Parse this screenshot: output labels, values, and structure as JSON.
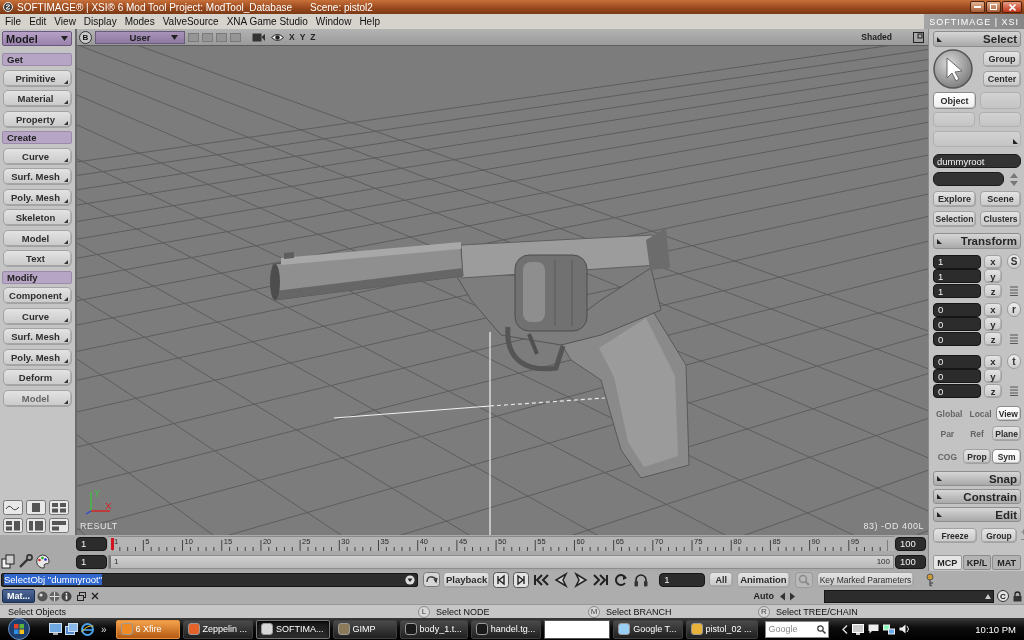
{
  "window": {
    "title": "SOFTIMAGE® | XSI® 6 Mod Tool Project: ModTool_Database",
    "scene": "Scene: pistol2"
  },
  "menu": [
    "File",
    "Edit",
    "View",
    "Display",
    "Modes",
    "ValveSource",
    "XNA Game Studio",
    "Window",
    "Help"
  ],
  "brand": "SOFTIMAGE | XSI",
  "module": "Model",
  "toolbar": [
    {
      "title": "Get",
      "buttons": [
        {
          "label": "Primitive",
          "disabled": false
        },
        {
          "label": "Material",
          "disabled": false
        },
        {
          "label": "Property",
          "disabled": false
        }
      ]
    },
    {
      "title": "Create",
      "buttons": [
        {
          "label": "Curve",
          "disabled": false
        },
        {
          "label": "Surf. Mesh",
          "disabled": false
        },
        {
          "label": "Poly. Mesh",
          "disabled": false
        },
        {
          "label": "Skeleton",
          "disabled": false
        },
        {
          "label": "Model",
          "disabled": false
        },
        {
          "label": "Text",
          "disabled": false
        }
      ]
    },
    {
      "title": "Modify",
      "buttons": [
        {
          "label": "Component",
          "disabled": false
        },
        {
          "label": "Curve",
          "disabled": false
        },
        {
          "label": "Surf. Mesh",
          "disabled": false
        },
        {
          "label": "Poly. Mesh",
          "disabled": false
        },
        {
          "label": "Deform",
          "disabled": false
        },
        {
          "label": "Model",
          "disabled": true
        }
      ]
    }
  ],
  "viewport": {
    "view_letter": "B",
    "camera": "User",
    "axes": [
      "X",
      "Y",
      "Z"
    ],
    "display_mode": "Shaded",
    "label": "RESULT",
    "stats": "83) -OD 400L"
  },
  "select_panel": {
    "title": "Select",
    "buttons": [
      "Group",
      "Center"
    ],
    "filters": [
      {
        "label": "Object",
        "selected": true
      }
    ],
    "name": "dummyroot",
    "browse_buttons": [
      "Explore",
      "Scene",
      "Selection",
      "Clusters"
    ]
  },
  "transform_panel": {
    "title": "Transform",
    "groups": [
      {
        "key": "S",
        "fields": [
          {
            "axis": "x",
            "value": "1"
          },
          {
            "axis": "y",
            "value": "1"
          },
          {
            "axis": "z",
            "value": "1"
          }
        ]
      },
      {
        "key": "r",
        "fields": [
          {
            "axis": "x",
            "value": "0"
          },
          {
            "axis": "y",
            "value": "0"
          },
          {
            "axis": "z",
            "value": "0"
          }
        ]
      },
      {
        "key": "t",
        "fields": [
          {
            "axis": "x",
            "value": "0"
          },
          {
            "axis": "y",
            "value": "0"
          },
          {
            "axis": "z",
            "value": "0"
          }
        ]
      }
    ],
    "mode_rows": [
      [
        {
          "label": "Global",
          "selected": false,
          "disabled": true
        },
        {
          "label": "Local",
          "selected": false,
          "disabled": true
        },
        {
          "label": "View",
          "selected": true,
          "disabled": false
        }
      ],
      [
        {
          "label": "Par",
          "selected": false,
          "disabled": true
        },
        {
          "label": "Ref",
          "selected": false,
          "disabled": true
        },
        {
          "label": "Plane",
          "selected": false,
          "disabled": false
        }
      ],
      [
        {
          "label": "COG",
          "selected": false,
          "disabled": true
        },
        {
          "label": "Prop",
          "selected": false,
          "disabled": false
        },
        {
          "label": "Sym",
          "selected": true,
          "disabled": false
        }
      ]
    ]
  },
  "collapsed_panels": [
    "Snap",
    "Constrain",
    "Edit"
  ],
  "edit_buttons": [
    "Freeze",
    "Group"
  ],
  "panel_tabs": [
    {
      "label": "MCP",
      "selected": true
    },
    {
      "label": "KP/L",
      "selected": false
    },
    {
      "label": "MAT",
      "selected": false
    }
  ],
  "timeline": {
    "start": "1",
    "end": "100",
    "labels": [
      "1",
      "5",
      "10",
      "15",
      "20",
      "25",
      "30",
      "35",
      "40",
      "45",
      "50",
      "55",
      "60",
      "65",
      "70",
      "75",
      "80",
      "85",
      "90",
      "95"
    ],
    "level": 0
  },
  "range": {
    "start": "1",
    "end": "100",
    "slider_start": "1",
    "slider_end": "100",
    "level": 1
  },
  "command_line": {
    "value": "SelectObj \"dummyroot\""
  },
  "playback": {
    "menu": "Playback",
    "frame": "1",
    "range_button": "All",
    "animation": "Animation",
    "auto": "Auto",
    "key_button": "Key Marked Parameters",
    "c_button": "C"
  },
  "layout_tab": "Mat...",
  "status_bar": {
    "message": "Select Objects",
    "mouse_hints": [
      {
        "button": "L",
        "action": "Select NODE"
      },
      {
        "button": "M",
        "action": "Select BRANCH"
      },
      {
        "button": "R",
        "action": "Select TREE/CHAIN"
      }
    ]
  },
  "taskbar": {
    "more": "»",
    "items": [
      {
        "kind": "window",
        "label": "6 Xfire",
        "selected": false,
        "attention": true
      },
      {
        "kind": "window",
        "label": "Zeppelin ...",
        "selected": false,
        "attention": false
      },
      {
        "kind": "window",
        "label": "SOFTIMA...",
        "selected": true,
        "attention": false
      },
      {
        "kind": "window",
        "label": "GIMP",
        "selected": false,
        "attention": false
      },
      {
        "kind": "window",
        "label": "body_1.t...",
        "selected": false,
        "attention": false
      },
      {
        "kind": "window",
        "label": "handel.tg...",
        "selected": false,
        "attention": false
      },
      {
        "kind": "blank",
        "selected": false,
        "attention": false
      },
      {
        "kind": "window",
        "label": "Google T...",
        "selected": false,
        "attention": false
      },
      {
        "kind": "window",
        "label": "pistol_02 ...",
        "selected": false,
        "attention": false
      }
    ],
    "search_placeholder": "Google",
    "clock": "10:10 PM"
  }
}
